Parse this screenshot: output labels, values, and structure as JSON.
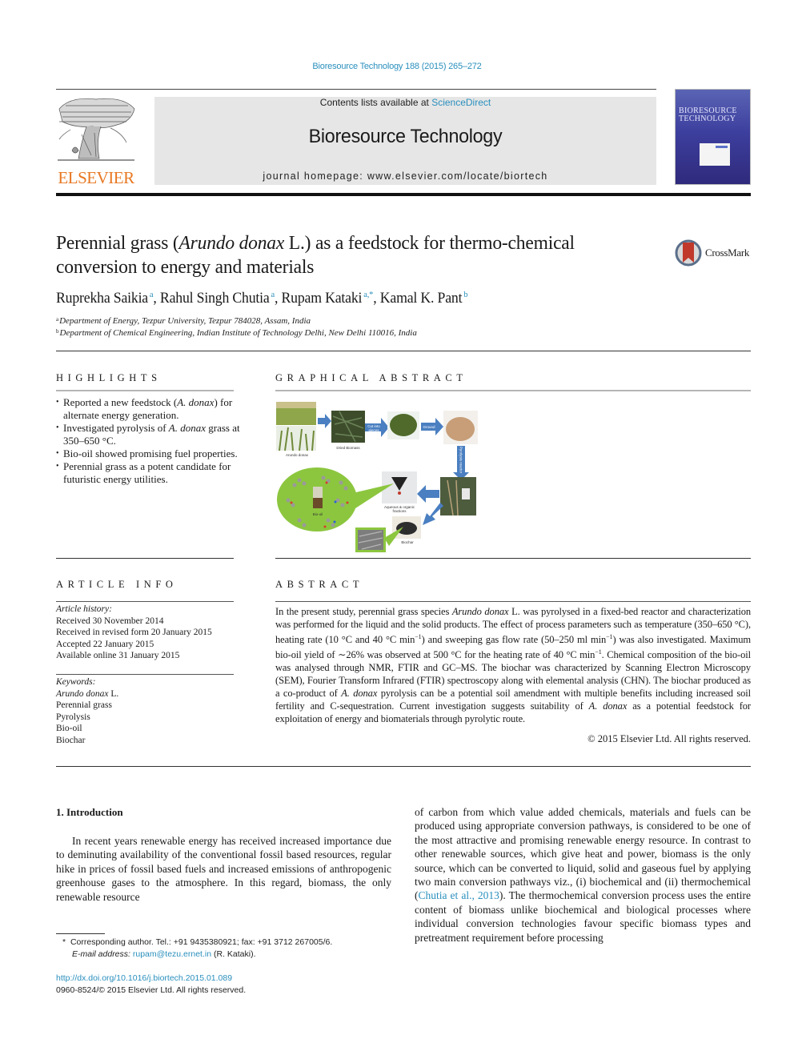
{
  "citation": "Bioresource Technology 188 (2015) 265–272",
  "masthead": {
    "publisher_logo_text": "ELSEVIER",
    "contents_prefix": "Contents lists available at ",
    "contents_link": "ScienceDirect",
    "journal_name": "Bioresource Technology",
    "homepage_prefix": "journal homepage: ",
    "homepage_url": "www.elsevier.com/locate/biortech",
    "cover_title": "BIORESOURCE TECHNOLOGY"
  },
  "article": {
    "title_part1": "Perennial grass (",
    "title_italic": "Arundo donax",
    "title_part2": " L.) as a feedstock for thermo-chemical conversion to energy and materials",
    "crossmark_label": "CrossMark",
    "authors": [
      {
        "name": "Ruprekha Saikia",
        "sup": "a"
      },
      {
        "name": "Rahul Singh Chutia",
        "sup": "a"
      },
      {
        "name": "Rupam Kataki",
        "sup": "a,*"
      },
      {
        "name": "Kamal K. Pant",
        "sup": "b"
      }
    ],
    "affiliations": [
      {
        "sup": "a",
        "text": "Department of Energy, Tezpur University, Tezpur 784028, Assam, India"
      },
      {
        "sup": "b",
        "text": "Department of Chemical Engineering, Indian Institute of Technology Delhi, New Delhi 110016, India"
      }
    ]
  },
  "highlights": {
    "heading": "HIGHLIGHTS",
    "items": [
      {
        "pre": "Reported a new feedstock (",
        "ital": "A. donax",
        "post": ") for alternate energy generation."
      },
      {
        "pre": "Investigated pyrolysis of ",
        "ital": "A. donax",
        "post": " grass at 350–650 °C."
      },
      {
        "pre": "Bio-oil showed promising fuel properties.",
        "ital": "",
        "post": ""
      },
      {
        "pre": "Perennial grass as a potent candidate for futuristic energy utilities.",
        "ital": "",
        "post": ""
      }
    ]
  },
  "graphical_abstract": {
    "heading": "GRAPHICAL ABSTRACT",
    "labels": {
      "plant": "Arundo donax",
      "dried": "Dried Biomass",
      "cut": "Cut into pieces",
      "ground": "Ground",
      "reactor": "Pyrolysis reactor",
      "fractions": "Aqueous & organic fractions",
      "biooil": "Bio-oil",
      "biochar": "Biochar"
    }
  },
  "article_info": {
    "heading": "ARTICLE INFO",
    "history_label": "Article history:",
    "history": [
      "Received 30 November 2014",
      "Received in revised form 20 January 2015",
      "Accepted 22 January 2015",
      "Available online 31 January 2015"
    ],
    "keywords_label": "Keywords:",
    "keyword_first_italic": "Arundo donax",
    "keyword_first_rest": " L.",
    "keywords": [
      "Perennial grass",
      "Pyrolysis",
      "Bio-oil",
      "Biochar"
    ]
  },
  "abstract": {
    "heading": "ABSTRACT",
    "s1": "In the present study, perennial grass species ",
    "s1_ital": "Arundo donax",
    "s2": " L. was pyrolysed in a fixed-bed reactor and characterization was performed for the liquid and the solid products. The effect of process parameters such as temperature (350–650 °C), heating rate (10 °C and 40 °C min",
    "sup1": "−1",
    "s3": ") and sweeping gas flow rate (50–250 ml min",
    "sup2": "−1",
    "s4": ") was also investigated. Maximum bio-oil yield of ∼26% was observed at 500 °C for the heating rate of 40 °C min",
    "sup3": "−1",
    "s5": ". Chemical composition of the bio-oil was analysed through NMR, FTIR and GC–MS. The biochar was characterized by Scanning Electron Microscopy (SEM), Fourier Transform Infrared (FTIR) spectroscopy along with elemental analysis (CHN). The biochar produced as a co-product of ",
    "s5_ital": "A. donax",
    "s6": " pyrolysis can be a potential soil amendment with multiple benefits including increased soil fertility and C-sequestration. Current investigation suggests suitability of ",
    "s6_ital": "A. donax",
    "s7": " as a potential feedstock for exploitation of energy and biomaterials through pyrolytic route.",
    "copyright": "© 2015 Elsevier Ltd. All rights reserved."
  },
  "introduction": {
    "heading": "1. Introduction",
    "p1": "In recent years renewable energy has received increased importance due to deminuting availability of the conventional fossil based resources, regular hike in prices of fossil based fuels and increased emissions of anthropogenic greenhouse gases to the atmosphere. In this regard, biomass, the only renewable resource",
    "p2_a": "of carbon from which value added chemicals, materials and fuels can be produced using appropriate conversion pathways, is considered to be one of the most attractive and promising renewable energy resource. In contrast to other renewable sources, which give heat and power, biomass is the only source, which can be converted to liquid, solid and gaseous fuel by applying two main conversion pathways viz., (i) biochemical and (ii) thermochemical (",
    "p2_cite": "Chutia et al., 2013",
    "p2_b": "). The thermochemical conversion process uses the entire content of biomass unlike biochemical and biological processes where individual conversion technologies favour specific biomass types and pretreatment requirement before processing"
  },
  "footnote": {
    "star": "*",
    "corresponding": "Corresponding author. Tel.: +91 9435380921; fax: +91 3712 267005/6.",
    "email_label": "E-mail address: ",
    "email": "rupam@tezu.ernet.in",
    "email_suffix": " (R. Kataki).",
    "doi": "http://dx.doi.org/10.1016/j.biortech.2015.01.089",
    "issn": "0960-8524/© 2015 Elsevier Ltd. All rights reserved."
  },
  "colors": {
    "link": "#2a8fbd",
    "elsevier_orange": "#e87722",
    "ga_arrow": "#4a7fc1",
    "ga_green": "#8cc63f"
  }
}
